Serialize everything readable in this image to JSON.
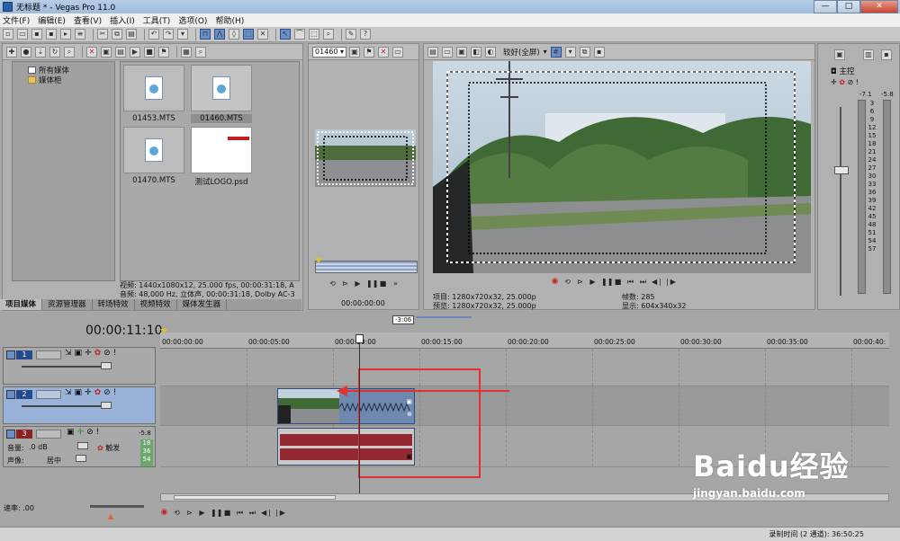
{
  "window": {
    "title": "无标题 * - Vegas Pro 11.0"
  },
  "menu": [
    "文件(F)",
    "编辑(E)",
    "查看(V)",
    "插入(I)",
    "工具(T)",
    "选项(O)",
    "帮助(H)"
  ],
  "explorer": {
    "tree": [
      {
        "label": "所有媒体",
        "selected": true
      },
      {
        "label": "媒体柜",
        "selected": false
      }
    ],
    "files": [
      {
        "name": "01453.MTS"
      },
      {
        "name": "01460.MTS"
      },
      {
        "name": "01470.MTS"
      },
      {
        "name": "测试LOGO.psd"
      }
    ],
    "info": [
      "视频: 1440x1080x12, 25.000 fps, 00:00:31:18, A",
      "音频: 48,000 Hz, 立体声, 00:00:31:18, Dolby AC-3"
    ],
    "tabs": [
      "项目媒体",
      "资源管理器",
      "转场特效",
      "视频特效",
      "媒体发生器"
    ]
  },
  "trimmer": {
    "clip_select": "01460",
    "timecode": "00:00:00:00"
  },
  "preview": {
    "quality": "较好(全屏)",
    "project": "项目: 1280x720x32, 25.000p",
    "preview_line": "预览: 1280x720x32, 25.000p",
    "frame": "帧数: 285",
    "display": "显示: 604x340x32"
  },
  "master": {
    "label": "主控",
    "peak_l": "-7.1",
    "peak_r": "-5.8",
    "scale": [
      "3",
      "6",
      "9",
      "12",
      "15",
      "18",
      "21",
      "24",
      "27",
      "30",
      "33",
      "36",
      "39",
      "42",
      "45",
      "48",
      "51",
      "54",
      "57"
    ]
  },
  "timeline": {
    "timecode": "00:00:11:10",
    "region_label": "-3:06",
    "ruler": [
      "00:00:00:00",
      "00:00:05:00",
      "00:00:10:00",
      "00:00:15:00",
      "00:00:20:00",
      "00:00:25:00",
      "00:00:30:00",
      "00:00:35:00",
      "00:00:40:"
    ],
    "tracks": [
      {
        "num": "1",
        "type": "video"
      },
      {
        "num": "2",
        "type": "video"
      },
      {
        "num": "3",
        "type": "audio",
        "volume_label": "音量:",
        "volume": ".0 dB",
        "pan_label": "声像:",
        "pan": "居中",
        "touch": "触发",
        "peak": "-5.8",
        "meter": [
          "18",
          "36",
          "54"
        ]
      }
    ],
    "rate": "速率: .00"
  },
  "status": {
    "record_time": "录制时间 (2 通道): 36:50:25"
  },
  "watermark": {
    "brand": "Baidu经验",
    "url": "jingyan.baidu.com"
  },
  "colors": {
    "accent": "#6a8fc7",
    "selection": "#98b2d8",
    "annotation": "#e53030",
    "waveform": "#8c1f2a"
  }
}
